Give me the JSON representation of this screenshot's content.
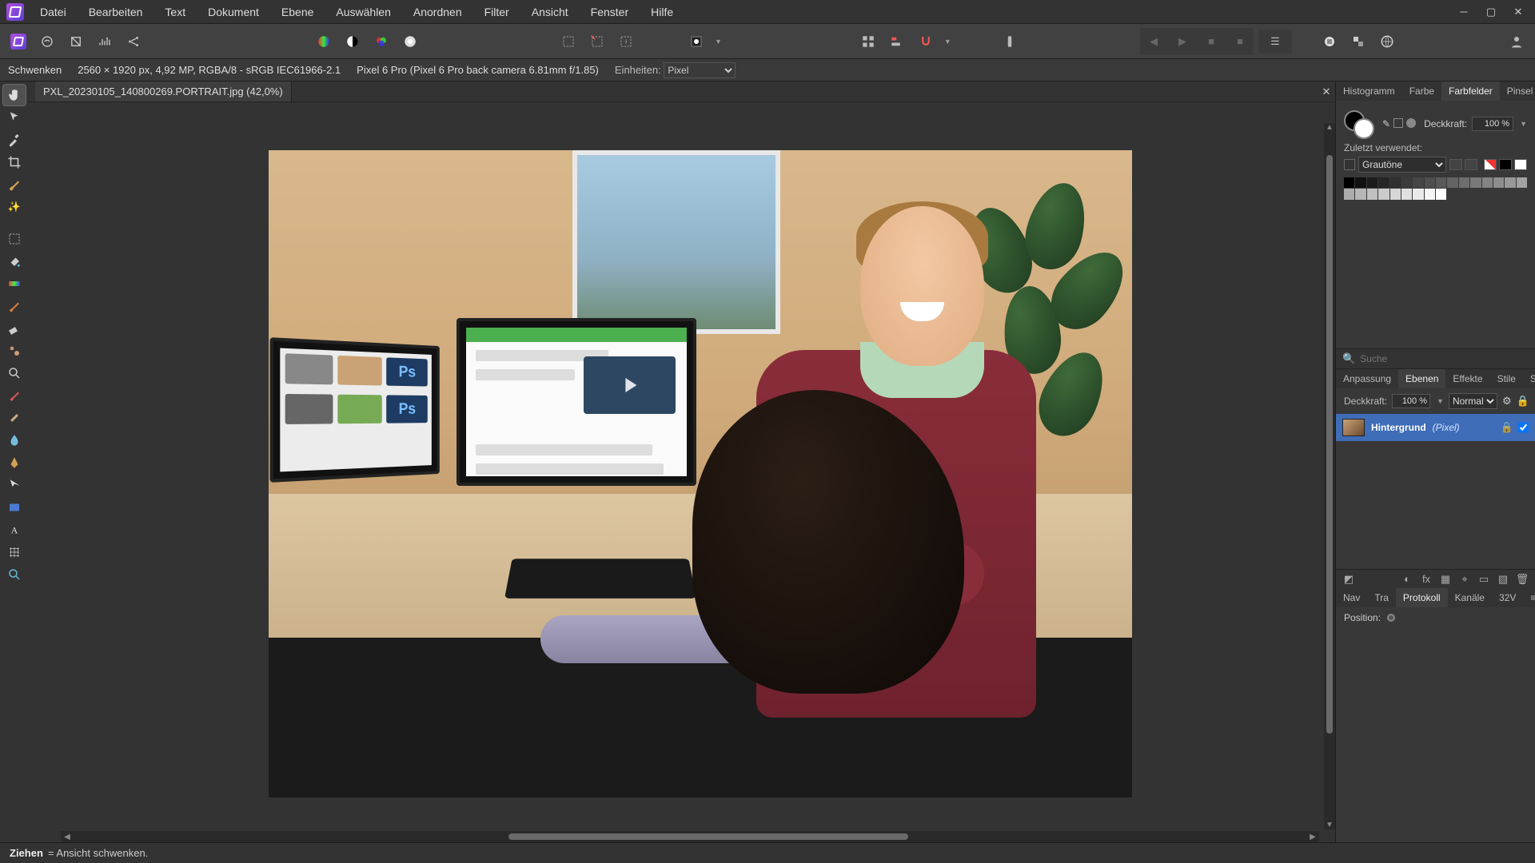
{
  "menu": {
    "items": [
      "Datei",
      "Bearbeiten",
      "Text",
      "Dokument",
      "Ebene",
      "Auswählen",
      "Anordnen",
      "Filter",
      "Ansicht",
      "Fenster",
      "Hilfe"
    ]
  },
  "context": {
    "tool_name": "Schwenken",
    "doc_info": "2560 × 1920 px, 4,92 MP, RGBA/8 - sRGB IEC61966-2.1",
    "camera": "Pixel 6 Pro (Pixel 6 Pro back camera 6.81mm f/1.85)",
    "units_label": "Einheiten:",
    "units_value": "Pixel"
  },
  "document": {
    "tab_title": "PXL_20230105_140800269.PORTRAIT.jpg (42,0%)"
  },
  "panels": {
    "swatches": {
      "tabs": [
        "Histogramm",
        "Farbe",
        "Farbfelder",
        "Pinsel"
      ],
      "active_tab": 2,
      "opacity_label": "Deckkraft:",
      "opacity_value": "100 %",
      "recent_label": "Zuletzt verwendet:",
      "palette_name": "Grautöne",
      "search_placeholder": "Suche"
    },
    "layers": {
      "tabs": [
        "Anpassung",
        "Ebenen",
        "Effekte",
        "Stile",
        "Stock"
      ],
      "active_tab": 1,
      "opacity_label": "Deckkraft:",
      "opacity_value": "100 %",
      "blend_mode": "Normal",
      "layer_name": "Hintergrund",
      "layer_type": "(Pixel)"
    },
    "protocol": {
      "tabs": [
        "Nav",
        "Tra",
        "Protokoll",
        "Kanäle",
        "32V"
      ],
      "active_tab": 2,
      "position_label": "Position:"
    }
  },
  "status": {
    "action": "Ziehen",
    "hint": " = Ansicht schwenken."
  },
  "swatch_greys": [
    "#000000",
    "#111111",
    "#1c1c1c",
    "#262626",
    "#303030",
    "#3b3b3b",
    "#454545",
    "#4f4f4f",
    "#5a5a5a",
    "#646464",
    "#6e6e6e",
    "#797979",
    "#838383",
    "#8d8d8d",
    "#989898",
    "#a2a2a2",
    "#acacac",
    "#b7b7b7",
    "#c1c1c1",
    "#cbcbcb",
    "#d6d6d6",
    "#e0e0e0",
    "#eaeaea",
    "#f5f5f5",
    "#ffffff"
  ]
}
